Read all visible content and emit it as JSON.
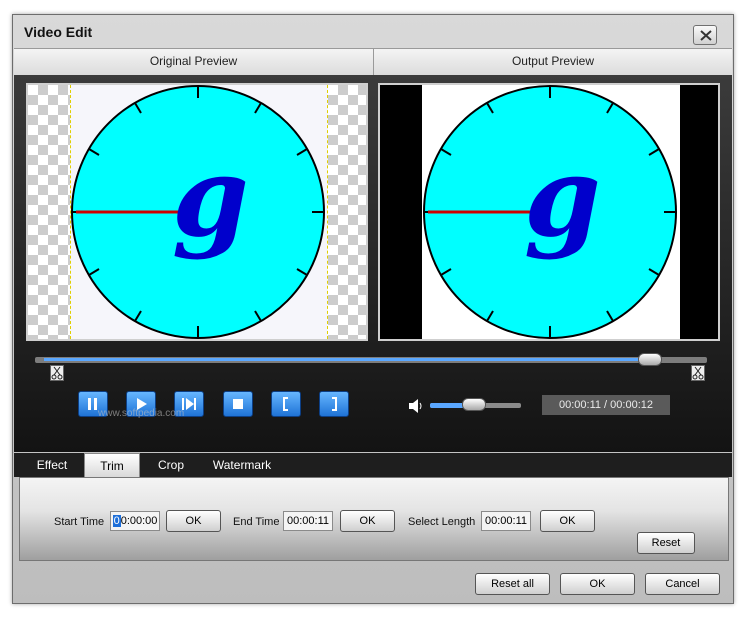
{
  "window": {
    "title": "Video Edit"
  },
  "preview": {
    "original_label": "Original Preview",
    "output_label": "Output Preview"
  },
  "clock": {
    "letter": "g",
    "face_color": "#00ffff",
    "hand_color": "#cc0000",
    "letter_color": "#0000cc"
  },
  "seek": {
    "position_fraction": 0.93
  },
  "volume": {
    "level_fraction": 0.47
  },
  "playback": {
    "time": "00:00:11 / 00:00:12",
    "controls": [
      "pause",
      "play",
      "next-frame",
      "stop",
      "mark-in",
      "mark-out"
    ]
  },
  "watermark_text": "www.softpedia.com",
  "tabs": [
    {
      "label": "Effect",
      "active": false
    },
    {
      "label": "Trim",
      "active": true
    },
    {
      "label": "Crop",
      "active": false
    },
    {
      "label": "Watermark",
      "active": false
    }
  ],
  "trim": {
    "start_label": "Start Time",
    "start_value_sel": "0",
    "start_value_rest": "0:00:00",
    "end_label": "End Time",
    "end_value": "00:00:11",
    "length_label": "Select Length",
    "length_value": "00:00:11",
    "ok_label": "OK",
    "reset_label": "Reset"
  },
  "footer": {
    "reset_all": "Reset all",
    "ok": "OK",
    "cancel": "Cancel"
  }
}
